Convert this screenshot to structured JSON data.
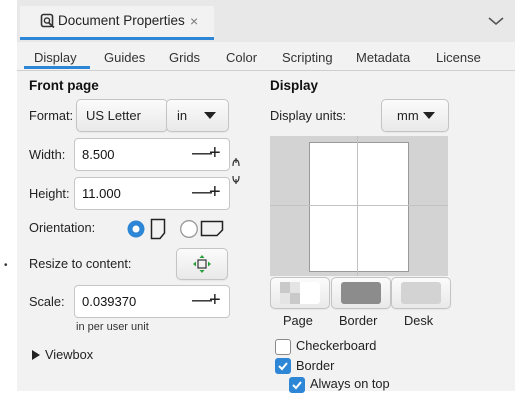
{
  "tab": {
    "title": "Document Properties",
    "close_glyph": "×"
  },
  "subtabs": [
    "Display",
    "Guides",
    "Grids",
    "Color",
    "Scripting",
    "Metadata",
    "License"
  ],
  "front_page": {
    "title": "Front page",
    "format_label": "Format:",
    "format_value": "US Letter",
    "unit_value": "in",
    "width_label": "Width:",
    "width_value": "8.500",
    "height_label": "Height:",
    "height_value": "11.000",
    "orientation_label": "Orientation:",
    "resize_label": "Resize to content:",
    "scale_label": "Scale:",
    "scale_value": "0.039370",
    "scale_note": "in per user unit",
    "viewbox_label": "Viewbox"
  },
  "display": {
    "title": "Display",
    "units_label": "Display units:",
    "units_value": "mm",
    "color_buttons": [
      "Page",
      "Border",
      "Desk"
    ],
    "checks": [
      {
        "label": "Checkerboard",
        "checked": false
      },
      {
        "label": "Border",
        "checked": true
      },
      {
        "label": "Always on top",
        "checked": true
      }
    ]
  },
  "steppers": {
    "minus": "—",
    "plus": "+"
  },
  "left_strip": {
    "bullet": "•"
  },
  "colors": {
    "accent": "#2e87d6",
    "desk": "#d3d3d3",
    "border_swatch": "#8c8c8c"
  }
}
